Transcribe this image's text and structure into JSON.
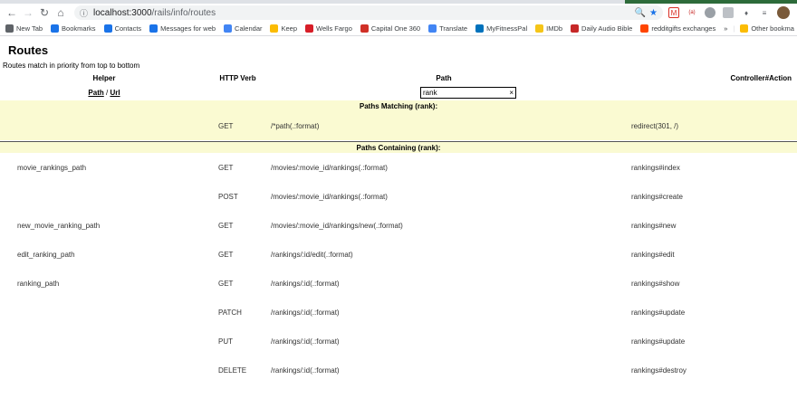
{
  "browser": {
    "url_host": "localhost:3000",
    "url_path": "/rails/info/routes",
    "bookmarks": [
      {
        "label": "New Tab",
        "icon": "grid-icon",
        "color": "#5f6368"
      },
      {
        "label": "Bookmarks",
        "icon": "star-icon",
        "color": "#1a73e8"
      },
      {
        "label": "Contacts",
        "icon": "contacts-icon",
        "color": "#1a73e8"
      },
      {
        "label": "Messages for web",
        "icon": "messages-icon",
        "color": "#1a73e8"
      },
      {
        "label": "Calendar",
        "icon": "calendar-icon",
        "color": "#4285f4"
      },
      {
        "label": "Keep",
        "icon": "keep-icon",
        "color": "#fbbc04"
      },
      {
        "label": "Wells Fargo",
        "icon": "wellsfargo-icon",
        "color": "#d71e28"
      },
      {
        "label": "Capital One 360",
        "icon": "capitalone-icon",
        "color": "#d03027"
      },
      {
        "label": "Translate",
        "icon": "translate-icon",
        "color": "#4285f4"
      },
      {
        "label": "MyFitnessPal",
        "icon": "myfitnesspal-icon",
        "color": "#0072bc"
      },
      {
        "label": "IMDb",
        "icon": "imdb-icon",
        "color": "#f5c518"
      },
      {
        "label": "Daily Audio Bible",
        "icon": "dab-icon",
        "color": "#c62828"
      },
      {
        "label": "redditgifts exchanges",
        "icon": "reddit-icon",
        "color": "#ff4500"
      }
    ],
    "overflow_label": "»",
    "other_bookmarks": "Other bookma"
  },
  "page": {
    "title": "Routes",
    "subtitle": "Routes match in priority from top to bottom"
  },
  "table": {
    "headers": [
      "Helper",
      "HTTP Verb",
      "Path",
      "Controller#Action"
    ],
    "path_link": "Path",
    "slash": " / ",
    "url_link": "Url",
    "search_value": "rank",
    "clear_icon": "×",
    "matching_header": "Paths Matching (rank):",
    "containing_header": "Paths Containing (rank):",
    "matching": [
      {
        "helper": "",
        "verb": "GET",
        "path": "/*path(.:format)",
        "action": "redirect(301, /)"
      }
    ],
    "containing": [
      {
        "helper": "movie_rankings_path",
        "verb": "GET",
        "path": "/movies/:movie_id/rankings(.:format)",
        "action": "rankings#index"
      },
      {
        "helper": "",
        "verb": "POST",
        "path": "/movies/:movie_id/rankings(.:format)",
        "action": "rankings#create"
      },
      {
        "helper": "new_movie_ranking_path",
        "verb": "GET",
        "path": "/movies/:movie_id/rankings/new(.:format)",
        "action": "rankings#new"
      },
      {
        "helper": "edit_ranking_path",
        "verb": "GET",
        "path": "/rankings/:id/edit(.:format)",
        "action": "rankings#edit"
      },
      {
        "helper": "ranking_path",
        "verb": "GET",
        "path": "/rankings/:id(.:format)",
        "action": "rankings#show"
      },
      {
        "helper": "",
        "verb": "PATCH",
        "path": "/rankings/:id(.:format)",
        "action": "rankings#update"
      },
      {
        "helper": "",
        "verb": "PUT",
        "path": "/rankings/:id(.:format)",
        "action": "rankings#update"
      },
      {
        "helper": "",
        "verb": "DELETE",
        "path": "/rankings/:id(.:format)",
        "action": "rankings#destroy"
      }
    ]
  }
}
